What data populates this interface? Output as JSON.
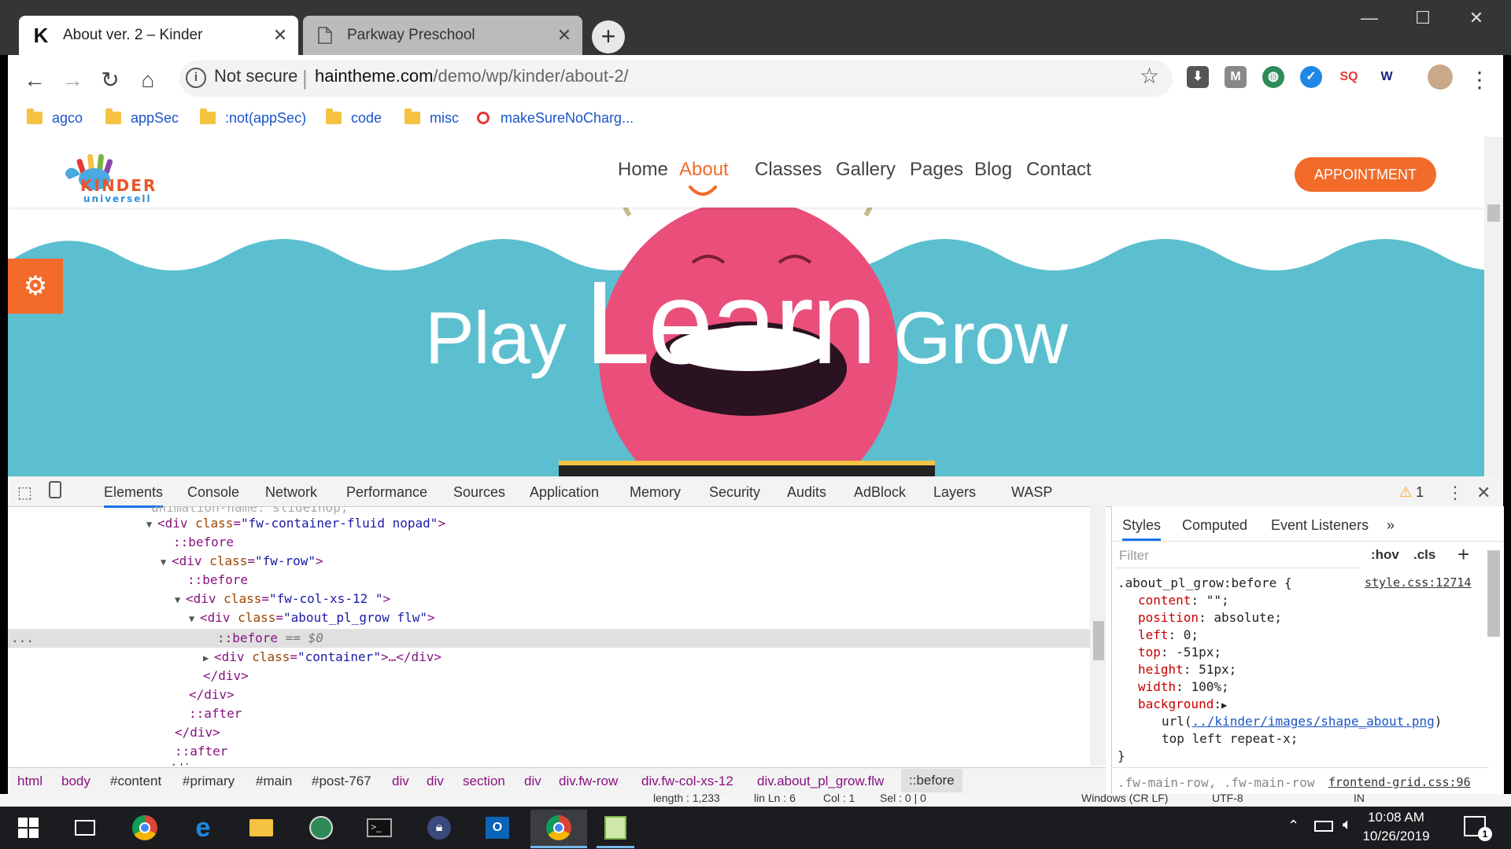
{
  "browser": {
    "tabs": [
      {
        "title": "About ver. 2 – Kinder",
        "icon": "K",
        "active": true
      },
      {
        "title": "Parkway Preschool",
        "icon": "page-icon",
        "active": false
      }
    ],
    "close_glyph": "✕",
    "new_tab_glyph": "+",
    "window_controls": {
      "minimize": "—",
      "maximize": "☐",
      "close": "✕"
    },
    "omnibox": {
      "security": "Not secure",
      "separator": "|",
      "host": "haintheme.com",
      "path": "/demo/wp/kinder/about-2/"
    },
    "bookmarks": [
      {
        "label": "agco",
        "type": "folder"
      },
      {
        "label": "appSec",
        "type": "folder"
      },
      {
        "label": ":not(appSec)",
        "type": "folder"
      },
      {
        "label": "code",
        "type": "folder"
      },
      {
        "label": "misc",
        "type": "folder"
      },
      {
        "label": "makeSureNoCharg...",
        "type": "link"
      }
    ]
  },
  "site": {
    "logo": {
      "title": "KINDER",
      "subtitle": "universell"
    },
    "nav": [
      "Home",
      "About",
      "Classes",
      "Gallery",
      "Pages",
      "Blog",
      "Contact"
    ],
    "active_nav": "About",
    "cta": "APPOINTMENT",
    "hero": {
      "word1": "Play",
      "word2": "Learn",
      "word3": "Grow"
    },
    "colors": {
      "accent": "#f26b2a",
      "wave": "#5bbfcf",
      "monster": "#e94f7a"
    }
  },
  "devtools": {
    "tabs": [
      "Elements",
      "Console",
      "Network",
      "Performance",
      "Sources",
      "Application",
      "Memory",
      "Security",
      "Audits",
      "AdBlock",
      "Layers",
      "WASP"
    ],
    "warning_count": "1",
    "cut_line": "animation-name: slideInUp;",
    "dom": [
      {
        "tri": "▼",
        "tag_open": "<div ",
        "attr": "class",
        "value": "\"fw-container-fluid nopad\"",
        "tag_close": ">"
      },
      {
        "pseudo": "::before"
      },
      {
        "tri": "▼",
        "tag_open": "<div ",
        "attr": "class",
        "value": "\"fw-row\"",
        "tag_close": ">"
      },
      {
        "pseudo": "::before"
      },
      {
        "tri": "▼",
        "tag_open": "<div ",
        "attr": "class",
        "value": "\"fw-col-xs-12 \"",
        "tag_close": ">"
      },
      {
        "tri": "▼",
        "tag_open": "<div ",
        "attr": "class",
        "value": "\"about_pl_grow flw\"",
        "tag_close": ">"
      },
      {
        "pseudo": "::before",
        "suffix": " == $0"
      },
      {
        "tri": "▶",
        "tag_open": "<div ",
        "attr": "class",
        "value": "\"container\"",
        "tag_close": ">…</div>"
      },
      {
        "close": "</div>"
      },
      {
        "close": "</div>"
      },
      {
        "pseudo": "::after"
      },
      {
        "close": "</div>"
      },
      {
        "pseudo": "::after"
      },
      {
        "close": "</div>"
      }
    ],
    "ellipsis": "...",
    "breadcrumbs": [
      "html",
      "body",
      "#content",
      "#primary",
      "#main",
      "#post-767",
      "div",
      "div",
      "section",
      "div",
      "div.fw-row",
      "div.fw-col-xs-12",
      "div.about_pl_grow.flw",
      "::before"
    ],
    "styles": {
      "tabs": [
        "Styles",
        "Computed",
        "Event Listeners",
        "»"
      ],
      "filter_placeholder": "Filter",
      "hov": ":hov",
      "cls": ".cls",
      "add": "+",
      "selector": ".about_pl_grow:before {",
      "source": "style.css:12714",
      "props": [
        {
          "name": "content",
          "value": "\"\";"
        },
        {
          "name": "position",
          "value": "absolute;"
        },
        {
          "name": "left",
          "value": "0;"
        },
        {
          "name": "top",
          "value": "-51px;"
        },
        {
          "name": "height",
          "value": "51px;"
        },
        {
          "name": "width",
          "value": "100%;"
        },
        {
          "name": "background",
          "value": "▶"
        }
      ],
      "bg_url_prefix": "url(",
      "bg_url": "../kinder/images/shape_about.png",
      "bg_url_suffix": ")",
      "bg_rest": "top left repeat-x;",
      "close_brace": "}",
      "next_selector": ".fw-main-row, .fw-main-row",
      "next_source": "frontend-grid.css:96"
    }
  },
  "status_strip": {
    "length": "length : 1,233",
    "ln": "lin Ln : 6",
    "col": "Col : 1",
    "sel": "Sel : 0 | 0",
    "eol": "Windows (CR LF)",
    "enc": "UTF-8",
    "mode": "IN"
  },
  "taskbar": {
    "time": "10:08 AM",
    "date": "10/26/2019",
    "notifications": "1"
  }
}
